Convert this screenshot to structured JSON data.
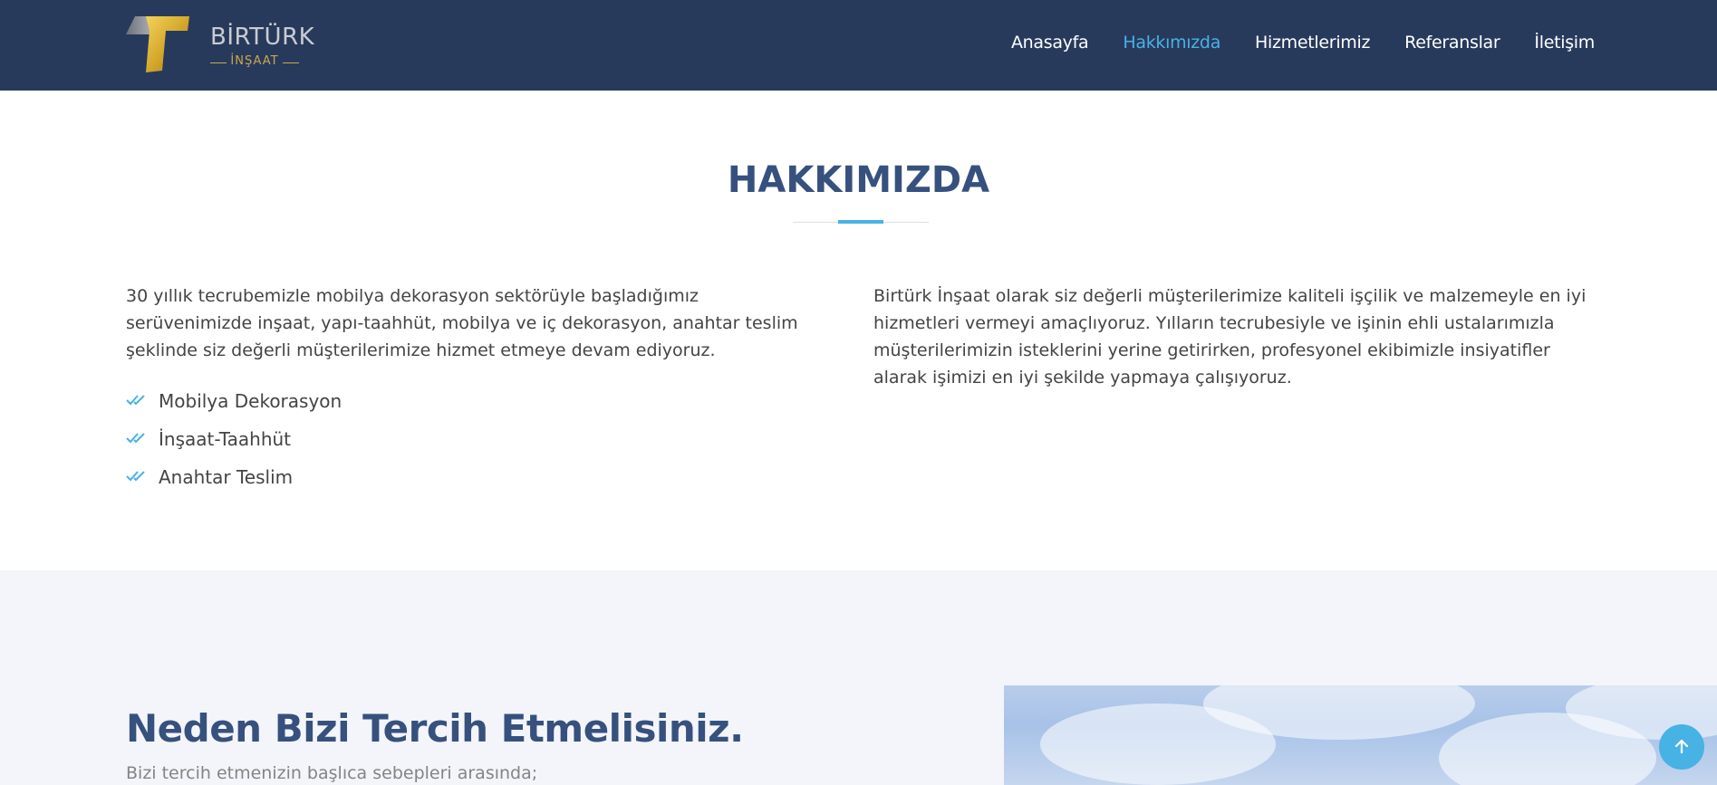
{
  "header": {
    "brand": "BİRTÜRK",
    "brand_sub": "İNŞAAT",
    "nav": [
      {
        "label": "Anasayfa",
        "active": false
      },
      {
        "label": "Hakkımızda",
        "active": true
      },
      {
        "label": "Hizmetlerimiz",
        "active": false
      },
      {
        "label": "Referanslar",
        "active": false
      },
      {
        "label": "İletişim",
        "active": false
      }
    ]
  },
  "about": {
    "title": "HAKKIMIZDA",
    "left_text": "30 yıllık tecrubemizle mobilya dekorasyon sektörüyle başladığımız serüvenimizde inşaat, yapı-taahhüt, mobilya ve iç dekorasyon, anahtar teslim şeklinde siz değerli müşterilerimize hizmet etmeye devam ediyoruz.",
    "services": [
      "Mobilya Dekorasyon",
      "İnşaat-Taahhüt",
      "Anahtar Teslim"
    ],
    "right_text": "Birtürk İnşaat olarak siz değerli müşterilerimize kaliteli işçilik ve malzemeyle en iyi hizmetleri vermeyi amaçlıyoruz. Yılların tecrubesiyle ve işinin ehli ustalarımızla müşterilerimizin isteklerini yerine getirirken, profesyonel ekibimizle insiyatifler alarak işimizi en iyi şekilde yapmaya çalışıyoruz."
  },
  "why": {
    "title": "Neden Bizi Tercih Etmelisiniz.",
    "subtitle": "Bizi tercih etmenizin başlıca sebepleri arasında;"
  },
  "colors": {
    "header_bg": "#283a5c",
    "accent": "#47b2e4",
    "heading": "#37517e",
    "section_alt_bg": "#f3f5fa",
    "logo_gold": "#c9a84c"
  },
  "icons": {
    "check": "double-check-icon",
    "back_to_top": "arrow-up-icon"
  }
}
